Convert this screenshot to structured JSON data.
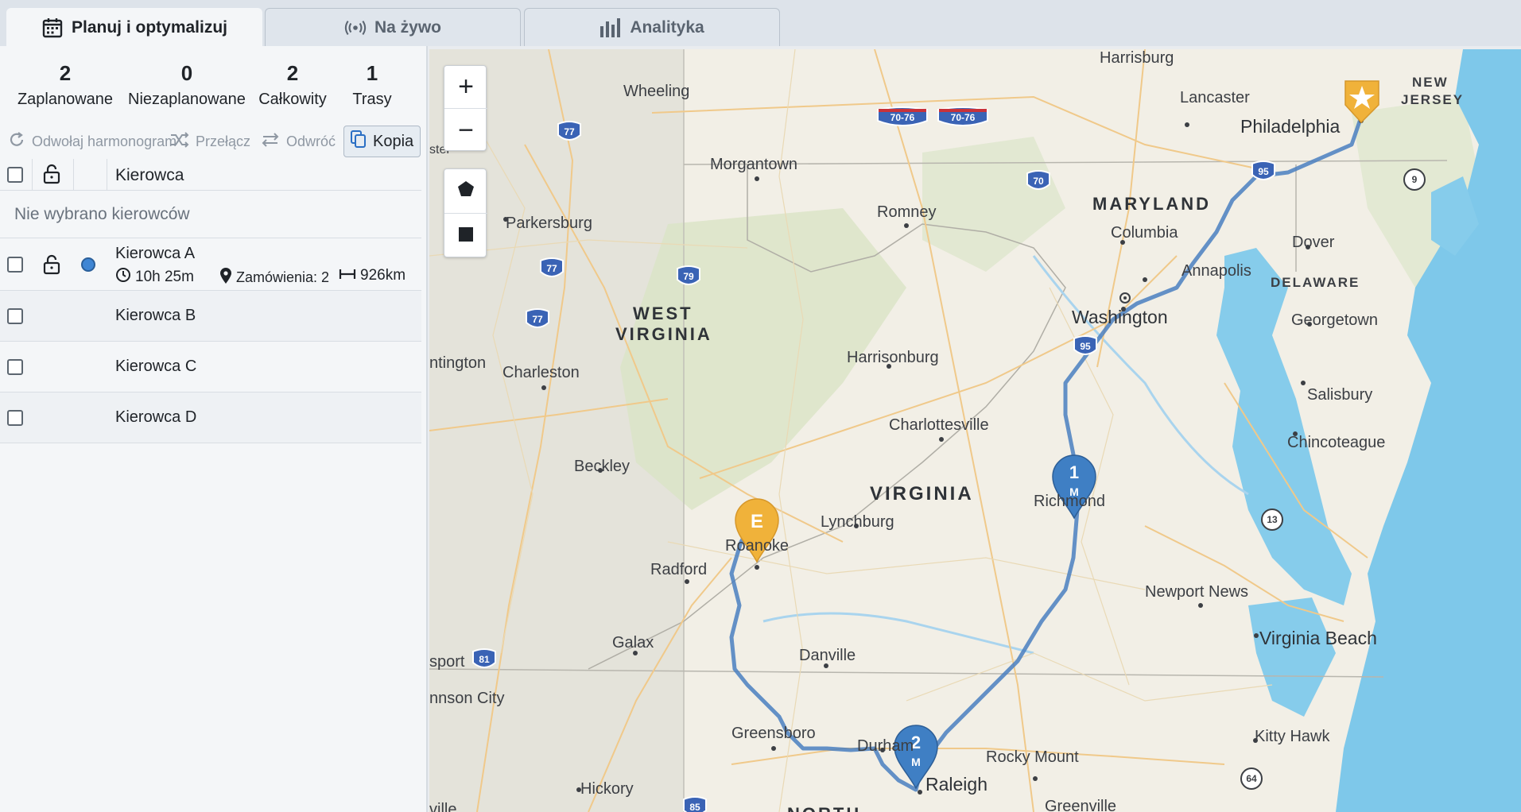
{
  "tabs": [
    {
      "label": "Planuj i optymalizuj",
      "icon": "calendar-icon",
      "active": true
    },
    {
      "label": "Na żywo",
      "icon": "broadcast-icon",
      "active": false
    },
    {
      "label": "Analityka",
      "icon": "bar-chart-icon",
      "active": false
    }
  ],
  "stats": [
    {
      "value": "2",
      "label": "Zaplanowane"
    },
    {
      "value": "0",
      "label": "Niezaplanowane"
    },
    {
      "value": "2",
      "label": "Całkowity"
    },
    {
      "value": "1",
      "label": "Trasy"
    }
  ],
  "actions": {
    "cancel_schedule": "Odwołaj harmonogram",
    "switch": "Przełącz",
    "reverse": "Odwróć",
    "copy": "Kopia"
  },
  "table": {
    "header_driver": "Kierowca",
    "no_selection": "Nie wybrano kierowców"
  },
  "drivers": [
    {
      "name": "Kierowca A",
      "duration": "10h 25m",
      "orders": "Zamówienia: 2",
      "distance": "926km",
      "color": "#3f86d4"
    },
    {
      "name": "Kierowca B"
    },
    {
      "name": "Kierowca C"
    },
    {
      "name": "Kierowca D"
    }
  ],
  "map": {
    "cities": {
      "harrisburg": "Harrisburg",
      "lancaster": "Lancaster",
      "philadelphia": "Philadelphia",
      "wheeling": "Wheeling",
      "morgantown": "Morgantown",
      "romney": "Romney",
      "parkersburg": "Parkersburg",
      "columbia": "Columbia",
      "annapolis": "Annapolis",
      "dover": "Dover",
      "washington": "Washington",
      "georgetown": "Georgetown",
      "charleston": "Charleston",
      "harrisonburg": "Harrisonburg",
      "salisbury": "Salisbury",
      "charlottesville": "Charlottesville",
      "beckley": "Beckley",
      "chincoteague": "Chincoteague",
      "richmond": "Richmond",
      "lynchburg": "Lynchburg",
      "roanoke": "Roanoke",
      "radford": "Radford",
      "newport_news": "Newport News",
      "galax": "Galax",
      "virginia_beach": "Virginia Beach",
      "danville": "Danville",
      "greensboro": "Greensboro",
      "durham": "Durham",
      "raleigh": "Raleigh",
      "rocky_mount": "Rocky Mount",
      "kitty_hawk": "Kitty Hawk",
      "hickory": "Hickory",
      "greenville": "Greenville",
      "johnson_city": "nnson City",
      "huntington": "ntington",
      "westport": "sport",
      "ville": "ville",
      "chester": "ster"
    },
    "states": {
      "maryland": "MARYLAND",
      "delaware": "DELAWARE",
      "new_jersey_1": "NEW",
      "new_jersey_2": "JERSEY",
      "west_virginia_1": "WEST",
      "west_virginia_2": "VIRGINIA",
      "virginia": "VIRGINIA",
      "north": "NORTH"
    },
    "shields": [
      "77",
      "70-76",
      "70-76",
      "70",
      "95",
      "9",
      "77",
      "79",
      "77",
      "95",
      "13",
      "81",
      "64",
      "85"
    ],
    "markers": {
      "stop1_num": "1",
      "stop1_type": "M",
      "stop2_num": "2",
      "stop2_type": "M",
      "end_label": "E"
    },
    "zoom_in": "+",
    "zoom_out": "−",
    "route_color": "#4a7fc0",
    "marker_blue": "#3f7fc4",
    "marker_orange": "#f0b23a"
  }
}
